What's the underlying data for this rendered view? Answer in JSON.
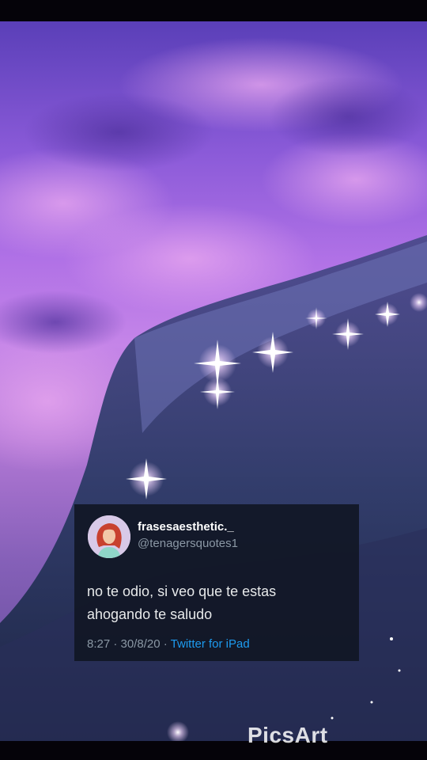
{
  "tweet": {
    "display_name": "frasesaesthetic._",
    "handle": "@tenagersquotes1",
    "text_line1": "no te odio, si veo que te estas",
    "text_line2": "ahogando te saludo",
    "time": "8:27",
    "date": "30/8/20",
    "separator": "·",
    "source": "Twitter for iPad"
  },
  "watermark": "PicsArt",
  "colors": {
    "link": "#1d9bf0",
    "muted": "#8b98a5",
    "card": "#111624"
  }
}
